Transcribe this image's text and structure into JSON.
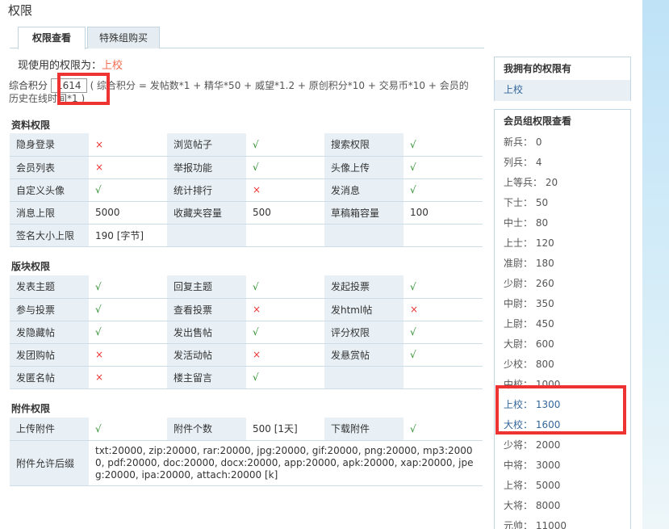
{
  "page": {
    "title": "权限"
  },
  "tabs": [
    {
      "label": "权限查看",
      "active": true
    },
    {
      "label": "特殊组购买",
      "active": false
    }
  ],
  "current": {
    "label": "现使用的权限为：",
    "value": "上校"
  },
  "score": {
    "label": "综合积分",
    "value": "1614",
    "formula": "( 综合积分 = 发帖数*1 + 精华*50 + 威望*1.2 + 原创积分*10 + 交易币*10 + 会员的历史在线时间*1 )"
  },
  "icons": {
    "yes": "√",
    "no": "×"
  },
  "sections": {
    "data": {
      "title": "资料权限",
      "rows": [
        [
          {
            "label": "隐身登录",
            "value": "×",
            "type": "no"
          },
          {
            "label": "浏览帖子",
            "value": "√",
            "type": "ok"
          },
          {
            "label": "搜索权限",
            "value": "√",
            "type": "ok"
          }
        ],
        [
          {
            "label": "会员列表",
            "value": "×",
            "type": "no"
          },
          {
            "label": "举报功能",
            "value": "√",
            "type": "ok"
          },
          {
            "label": "头像上传",
            "value": "√",
            "type": "ok"
          }
        ],
        [
          {
            "label": "自定义头像",
            "value": "√",
            "type": "ok"
          },
          {
            "label": "统计排行",
            "value": "×",
            "type": "no"
          },
          {
            "label": "发消息",
            "value": "√",
            "type": "ok"
          }
        ],
        [
          {
            "label": "消息上限",
            "value": "5000",
            "type": "text"
          },
          {
            "label": "收藏夹容量",
            "value": "500",
            "type": "text"
          },
          {
            "label": "草稿箱容量",
            "value": "100",
            "type": "text"
          }
        ],
        [
          {
            "label": "签名大小上限",
            "value": "190 [字节]",
            "type": "text"
          },
          {
            "label": "",
            "value": "",
            "type": "text"
          },
          {
            "label": "",
            "value": "",
            "type": "text"
          }
        ]
      ]
    },
    "board": {
      "title": "版块权限",
      "rows": [
        [
          {
            "label": "发表主题",
            "value": "√",
            "type": "ok"
          },
          {
            "label": "回复主题",
            "value": "√",
            "type": "ok"
          },
          {
            "label": "发起投票",
            "value": "√",
            "type": "ok"
          }
        ],
        [
          {
            "label": "参与投票",
            "value": "√",
            "type": "ok"
          },
          {
            "label": "查看投票",
            "value": "×",
            "type": "no"
          },
          {
            "label": "发html帖",
            "value": "×",
            "type": "no"
          }
        ],
        [
          {
            "label": "发隐藏帖",
            "value": "√",
            "type": "ok"
          },
          {
            "label": "发出售帖",
            "value": "√",
            "type": "ok"
          },
          {
            "label": "评分权限",
            "value": "√",
            "type": "ok"
          }
        ],
        [
          {
            "label": "发团购帖",
            "value": "×",
            "type": "no"
          },
          {
            "label": "发活动帖",
            "value": "×",
            "type": "no"
          },
          {
            "label": "发悬赏帖",
            "value": "√",
            "type": "ok"
          }
        ],
        [
          {
            "label": "发匿名帖",
            "value": "×",
            "type": "no"
          },
          {
            "label": "楼主留言",
            "value": "√",
            "type": "ok"
          },
          {
            "label": "",
            "value": "",
            "type": "text"
          }
        ]
      ]
    },
    "attach": {
      "title": "附件权限",
      "rows": [
        [
          {
            "label": "上传附件",
            "value": "√",
            "type": "ok"
          },
          {
            "label": "附件个数",
            "value": "500 [1天]",
            "type": "text"
          },
          {
            "label": "下载附件",
            "value": "√",
            "type": "ok"
          }
        ]
      ],
      "ext_label": "附件允许后缀",
      "ext_value": "txt:20000, zip:20000, rar:20000, jpg:20000, gif:20000, png:20000, mp3:20000, pdf:20000, doc:20000, docx:20000, app:20000, apk:20000, xap:20000, jpeg:20000, ipa:20000, attach:20000 [k]"
    }
  },
  "sidebar": {
    "owned_title": "我拥有的权限有",
    "owned_item": "上校",
    "groups_title": "会员组权限查看",
    "ranks": [
      {
        "name": "新兵",
        "score": "0"
      },
      {
        "name": "列兵",
        "score": "4"
      },
      {
        "name": "上等兵",
        "score": "20"
      },
      {
        "name": "下士",
        "score": "50"
      },
      {
        "name": "中士",
        "score": "80"
      },
      {
        "name": "上士",
        "score": "120"
      },
      {
        "name": "准尉",
        "score": "180"
      },
      {
        "name": "少尉",
        "score": "260"
      },
      {
        "name": "中尉",
        "score": "350"
      },
      {
        "name": "上尉",
        "score": "450"
      },
      {
        "name": "大尉",
        "score": "600"
      },
      {
        "name": "少校",
        "score": "800"
      },
      {
        "name": "中校",
        "score": "1000"
      },
      {
        "name": "上校",
        "score": "1300"
      },
      {
        "name": "大校",
        "score": "1600"
      },
      {
        "name": "少将",
        "score": "2000"
      },
      {
        "name": "中将",
        "score": "3000"
      },
      {
        "name": "上将",
        "score": "5000"
      },
      {
        "name": "大将",
        "score": "8000"
      },
      {
        "name": "元帅",
        "score": "11000"
      }
    ]
  }
}
